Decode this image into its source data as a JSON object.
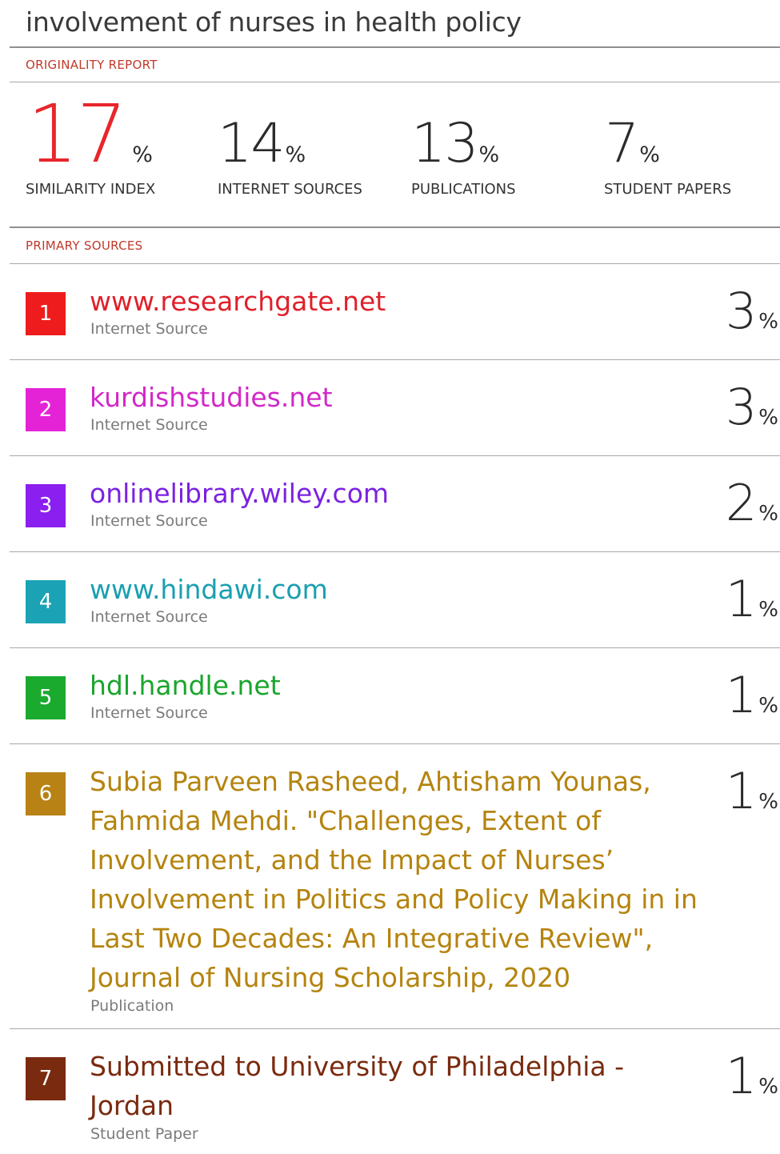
{
  "document": {
    "title": "involvement of nurses in health policy"
  },
  "originality_report": {
    "label": "ORIGINALITY REPORT",
    "stats": [
      {
        "value": "17",
        "unit": "%",
        "label": "SIMILARITY INDEX"
      },
      {
        "value": "14",
        "unit": "%",
        "label": "INTERNET SOURCES"
      },
      {
        "value": "13",
        "unit": "%",
        "label": "PUBLICATIONS"
      },
      {
        "value": "7",
        "unit": "%",
        "label": "STUDENT PAPERS"
      }
    ]
  },
  "primary_sources": {
    "label": "PRIMARY SOURCES",
    "items": [
      {
        "rank": "1",
        "color": "#ee1c1c",
        "title_color": "#e0202a",
        "title_lines": [
          "www.researchgate.net"
        ],
        "type": "Internet Source",
        "percent": "3",
        "unit": "%"
      },
      {
        "rank": "2",
        "color": "#e523d6",
        "title_color": "#d228c8",
        "title_lines": [
          "kurdishstudies.net"
        ],
        "type": "Internet Source",
        "percent": "3",
        "unit": "%"
      },
      {
        "rank": "3",
        "color": "#8a1ff0",
        "title_color": "#7b22e0",
        "title_lines": [
          "onlinelibrary.wiley.com"
        ],
        "type": "Internet Source",
        "percent": "2",
        "unit": "%"
      },
      {
        "rank": "4",
        "color": "#1ba3b5",
        "title_color": "#1a9fb0",
        "title_lines": [
          "www.hindawi.com"
        ],
        "type": "Internet Source",
        "percent": "1",
        "unit": "%"
      },
      {
        "rank": "5",
        "color": "#1aaa2e",
        "title_color": "#1aa52c",
        "title_lines": [
          "hdl.handle.net"
        ],
        "type": "Internet Source",
        "percent": "1",
        "unit": "%"
      },
      {
        "rank": "6",
        "color": "#b88214",
        "title_color": "#b5840f",
        "title_lines": [
          "Subia Parveen Rasheed, Ahtisham Younas,",
          "Fahmida Mehdi. \"Challenges, Extent of",
          "Involvement, and the Impact of Nurses’",
          "Involvement in Politics and Policy Making in in",
          "Last Two Decades: An Integrative Review\",",
          "Journal of Nursing Scholarship, 2020"
        ],
        "type": "Publication",
        "percent": "1",
        "unit": "%"
      },
      {
        "rank": "7",
        "color": "#7a2a0e",
        "title_color": "#7a2a0e",
        "title_lines": [
          "Submitted to University of Philadelphia -",
          "Jordan"
        ],
        "type": "Student Paper",
        "percent": "1",
        "unit": "%"
      }
    ]
  }
}
